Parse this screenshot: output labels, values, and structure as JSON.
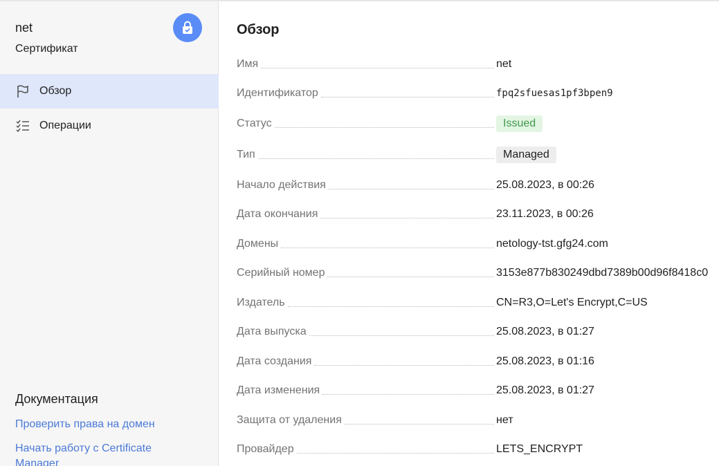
{
  "resource": {
    "name": "net",
    "type": "Сертификат",
    "icon": "lock-badge-icon"
  },
  "nav": {
    "items": [
      {
        "label": "Обзор",
        "icon": "flag-icon",
        "active": true
      },
      {
        "label": "Операции",
        "icon": "checklist-icon",
        "active": false
      }
    ]
  },
  "docs": {
    "title": "Документация",
    "links": [
      "Проверить права на домен",
      "Начать работу с Certificate Manager"
    ]
  },
  "overview": {
    "title": "Обзор",
    "properties": [
      {
        "label": "Имя",
        "value": "net"
      },
      {
        "label": "Идентификатор",
        "value": "fpq2sfuesas1pf3bpen9"
      },
      {
        "label": "Статус",
        "value": "Issued"
      },
      {
        "label": "Тип",
        "value": "Managed"
      },
      {
        "label": "Начало действия",
        "value": "25.08.2023, в 00:26"
      },
      {
        "label": "Дата окончания",
        "value": "23.11.2023, в 00:26"
      },
      {
        "label": "Домены",
        "value": "netology-tst.gfg24.com"
      },
      {
        "label": "Серийный номер",
        "value": "3153e877b830249dbd7389b00d96f8418c0"
      },
      {
        "label": "Издатель",
        "value": "CN=R3,O=Let's Encrypt,C=US"
      },
      {
        "label": "Дата выпуска",
        "value": "25.08.2023, в 01:27"
      },
      {
        "label": "Дата создания",
        "value": "25.08.2023, в 01:16"
      },
      {
        "label": "Дата изменения",
        "value": "25.08.2023, в 01:27"
      },
      {
        "label": "Защита от удаления",
        "value": "нет"
      },
      {
        "label": "Провайдер",
        "value": "LETS_ENCRYPT"
      }
    ]
  },
  "colors": {
    "accent": "#5a8cf7",
    "active_nav": "#dfe7fb",
    "link": "#4b79d8",
    "issued_bg": "#e3f5e3",
    "issued_text": "#3f9a4a"
  }
}
